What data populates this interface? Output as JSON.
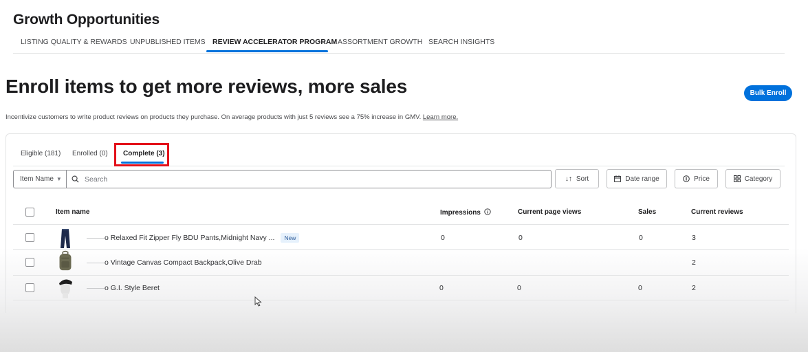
{
  "header": {
    "title": "Growth Opportunities"
  },
  "nav": {
    "tabs": [
      {
        "label": "LISTING QUALITY & REWARDS"
      },
      {
        "label": "UNPUBLISHED ITEMS"
      },
      {
        "label": "REVIEW ACCELERATOR PROGRAM",
        "active": true
      },
      {
        "label": "ASSORTMENT GROWTH"
      },
      {
        "label": "SEARCH INSIGHTS"
      }
    ]
  },
  "hero": {
    "title": "Enroll items to get more reviews, more sales",
    "bulk_enroll": "Bulk Enroll",
    "description": "Incentivize customers to write product reviews on products they purchase. On average products with just 5 reviews see a 75% increase in GMV.",
    "learn_more": "Learn more."
  },
  "status_tabs": [
    {
      "label": "Eligible (181)"
    },
    {
      "label": "Enrolled (0)"
    },
    {
      "label": "Complete (3)",
      "active": true
    }
  ],
  "filters": {
    "field_select": "Item Name",
    "search_placeholder": "Search",
    "sort": "Sort",
    "date_range": "Date range",
    "price": "Price",
    "category": "Category"
  },
  "table": {
    "columns": {
      "item_name": "Item name",
      "impressions": "Impressions",
      "page_views": "Current page views",
      "sales": "Sales",
      "reviews": "Current reviews"
    },
    "rows": [
      {
        "name": "o Relaxed Fit Zipper Fly BDU Pants,Midnight Navy ...",
        "badge": "New",
        "impressions": "0",
        "page_views": "0",
        "sales": "0",
        "reviews": "3",
        "thumb": "pants-thumbnail"
      },
      {
        "name": "o Vintage Canvas Compact Backpack,Olive Drab",
        "badge": "",
        "impressions": "",
        "page_views": "",
        "sales": "",
        "reviews": "2",
        "thumb": "backpack-thumbnail"
      },
      {
        "name": "o G.I. Style Beret",
        "badge": "",
        "impressions": "0",
        "page_views": "0",
        "sales": "0",
        "reviews": "2",
        "thumb": "beret-thumbnail"
      }
    ]
  },
  "colors": {
    "accent": "#0071dc",
    "highlight": "#e3111a"
  }
}
